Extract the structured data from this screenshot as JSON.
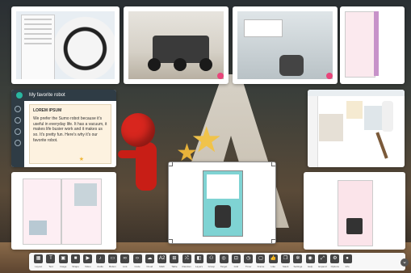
{
  "cards": {
    "c5": {
      "title": "My favorite robot",
      "subtitle": "LOREM IPSUM",
      "text": "We prefer the Sumo robot because it's useful in everyday life. It has a vacuum, it makes life busier work and it makes us so. It's pretty fun. Here's why it's our favorite robot."
    }
  },
  "toolbar": {
    "tools": [
      {
        "icon": "layout-icon",
        "glyph": "▦",
        "label": "Layout"
      },
      {
        "icon": "text-icon",
        "glyph": "T",
        "label": "Text"
      },
      {
        "icon": "image-icon",
        "glyph": "▣",
        "label": "Image"
      },
      {
        "icon": "shape-icon",
        "glyph": "■",
        "label": "Shape"
      },
      {
        "icon": "video-icon",
        "glyph": "▶",
        "label": "Video"
      },
      {
        "icon": "audio-icon",
        "glyph": "♪",
        "label": "Audio"
      },
      {
        "icon": "button-icon",
        "glyph": "▭",
        "label": "Button"
      },
      {
        "icon": "link-icon",
        "glyph": "∞",
        "label": "Link"
      },
      {
        "icon": "code-icon",
        "glyph": "‹›",
        "label": "Code"
      },
      {
        "icon": "cloud-icon",
        "glyph": "☁",
        "label": "Cloud"
      },
      {
        "icon": "math-icon",
        "glyph": "A2",
        "label": "Math"
      },
      {
        "icon": "table-icon",
        "glyph": "⊞",
        "label": "Table"
      },
      {
        "icon": "shuffle-icon",
        "glyph": "⤮",
        "label": "Random"
      },
      {
        "icon": "layers-icon",
        "glyph": "◧",
        "label": "Layers"
      },
      {
        "icon": "group-icon",
        "glyph": "⚇",
        "label": "Group"
      },
      {
        "icon": "target-icon",
        "glyph": "◎",
        "label": "Target"
      },
      {
        "icon": "grid-icon",
        "glyph": "⊡",
        "label": "Grid"
      },
      {
        "icon": "timer-icon",
        "glyph": "◷",
        "label": "Timer"
      },
      {
        "icon": "frame-icon",
        "glyph": "▢",
        "label": "Frame"
      },
      {
        "icon": "like-icon",
        "glyph": "👍",
        "label": "Like"
      },
      {
        "icon": "stack-icon",
        "glyph": "❐",
        "label": "Stack"
      },
      {
        "icon": "settings-icon",
        "glyph": "✲",
        "label": "Settings"
      },
      {
        "icon": "help-icon",
        "glyph": "◉",
        "label": "Help"
      },
      {
        "icon": "expand-icon",
        "glyph": "⤢",
        "label": "Expand"
      },
      {
        "icon": "gear-icon",
        "glyph": "⚙",
        "label": "Options"
      },
      {
        "icon": "info-icon",
        "glyph": "●",
        "label": "Info"
      }
    ],
    "collapse_glyph": "⌄"
  }
}
